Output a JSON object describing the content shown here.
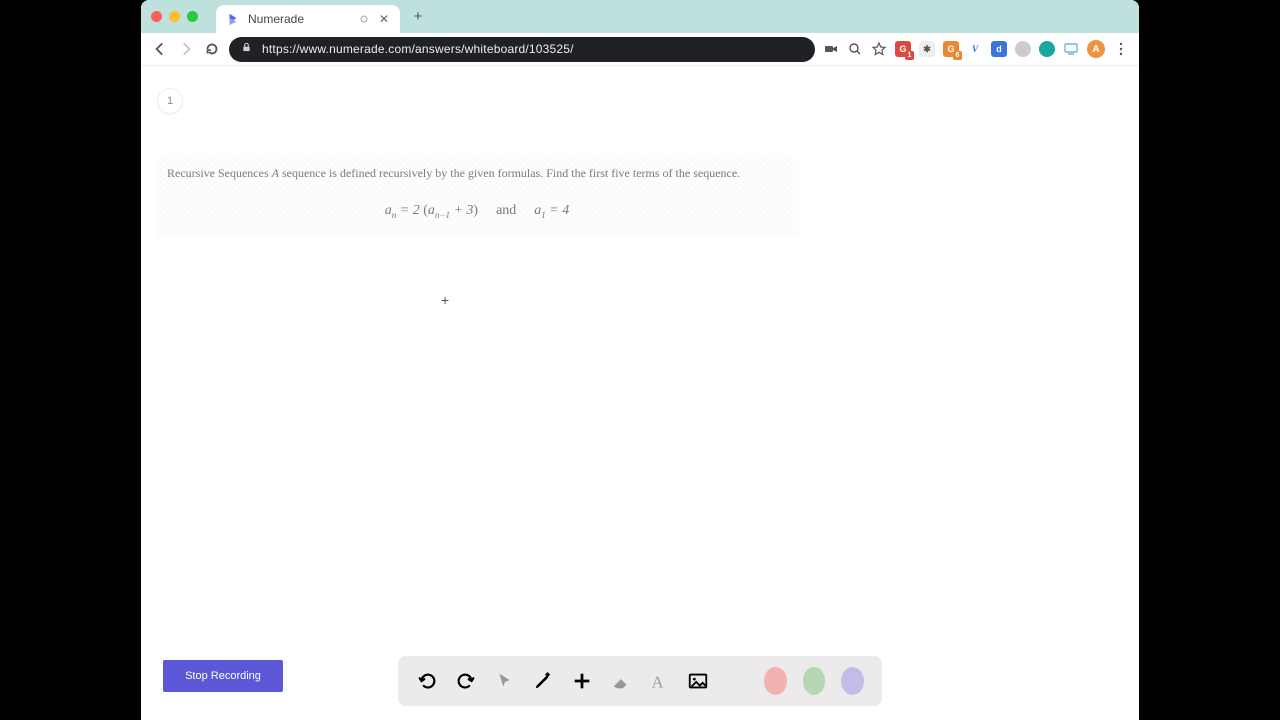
{
  "titlebar": {
    "tab_title": "Numerade"
  },
  "addressbar": {
    "url": "https://www.numerade.com/answers/whiteboard/103525/"
  },
  "extensions": {
    "g": "G",
    "g_badge": "1",
    "g2_badge": "6",
    "v": "V",
    "d": "d"
  },
  "avatar": {
    "initial": "A"
  },
  "content": {
    "bubble": "1",
    "problem_prefix": "Recursive Sequences ",
    "problem_italic_A": "A",
    "problem_suffix": " sequence is defined recursively by the given formulas. Find the first five terms of the sequence.",
    "formula": {
      "a": "a",
      "sub_n": "n",
      "eq2": "= 2 ",
      "lparen": "(",
      "sub_nm1": "n−1",
      "plus3": " + 3",
      "rparen": ")",
      "and": "and",
      "sub_1": "1",
      "eq4": " = 4"
    }
  },
  "buttons": {
    "stop_recording": "Stop Recording"
  },
  "toolbar": {
    "colors": {
      "black": "#000000",
      "pink": "#f2b2b0",
      "green": "#b6d7b1",
      "purple": "#c3bce6"
    }
  }
}
